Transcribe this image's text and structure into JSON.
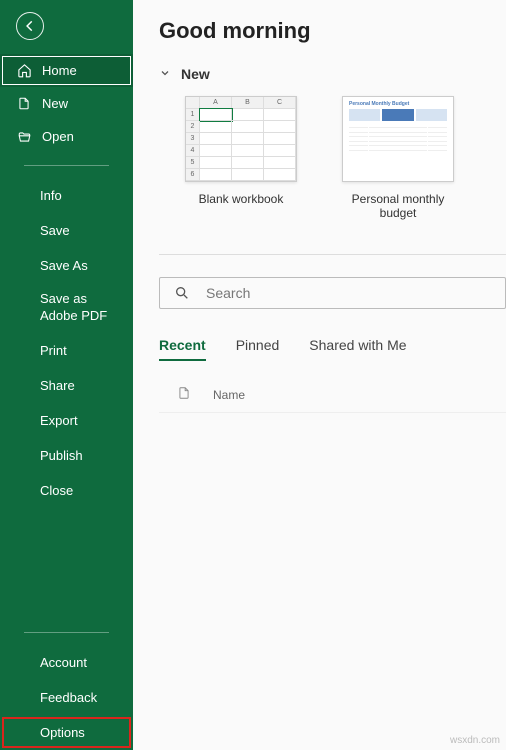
{
  "sidebar": {
    "primary": [
      {
        "label": "Home",
        "icon": "home-icon"
      },
      {
        "label": "New",
        "icon": "new-icon"
      },
      {
        "label": "Open",
        "icon": "open-icon"
      }
    ],
    "secondary": [
      "Info",
      "Save",
      "Save As",
      "Save as Adobe PDF",
      "Print",
      "Share",
      "Export",
      "Publish",
      "Close"
    ],
    "footer": [
      "Account",
      "Feedback",
      "Options"
    ]
  },
  "main": {
    "greeting": "Good morning",
    "new_section_label": "New",
    "templates": [
      {
        "label": "Blank workbook"
      },
      {
        "label": "Personal monthly budget"
      }
    ],
    "search_placeholder": "Search",
    "tabs": [
      "Recent",
      "Pinned",
      "Shared with Me"
    ],
    "list_header_name": "Name",
    "budget_thumb_title": "Personal Monthly Budget"
  },
  "watermark": "wsxdn.com"
}
